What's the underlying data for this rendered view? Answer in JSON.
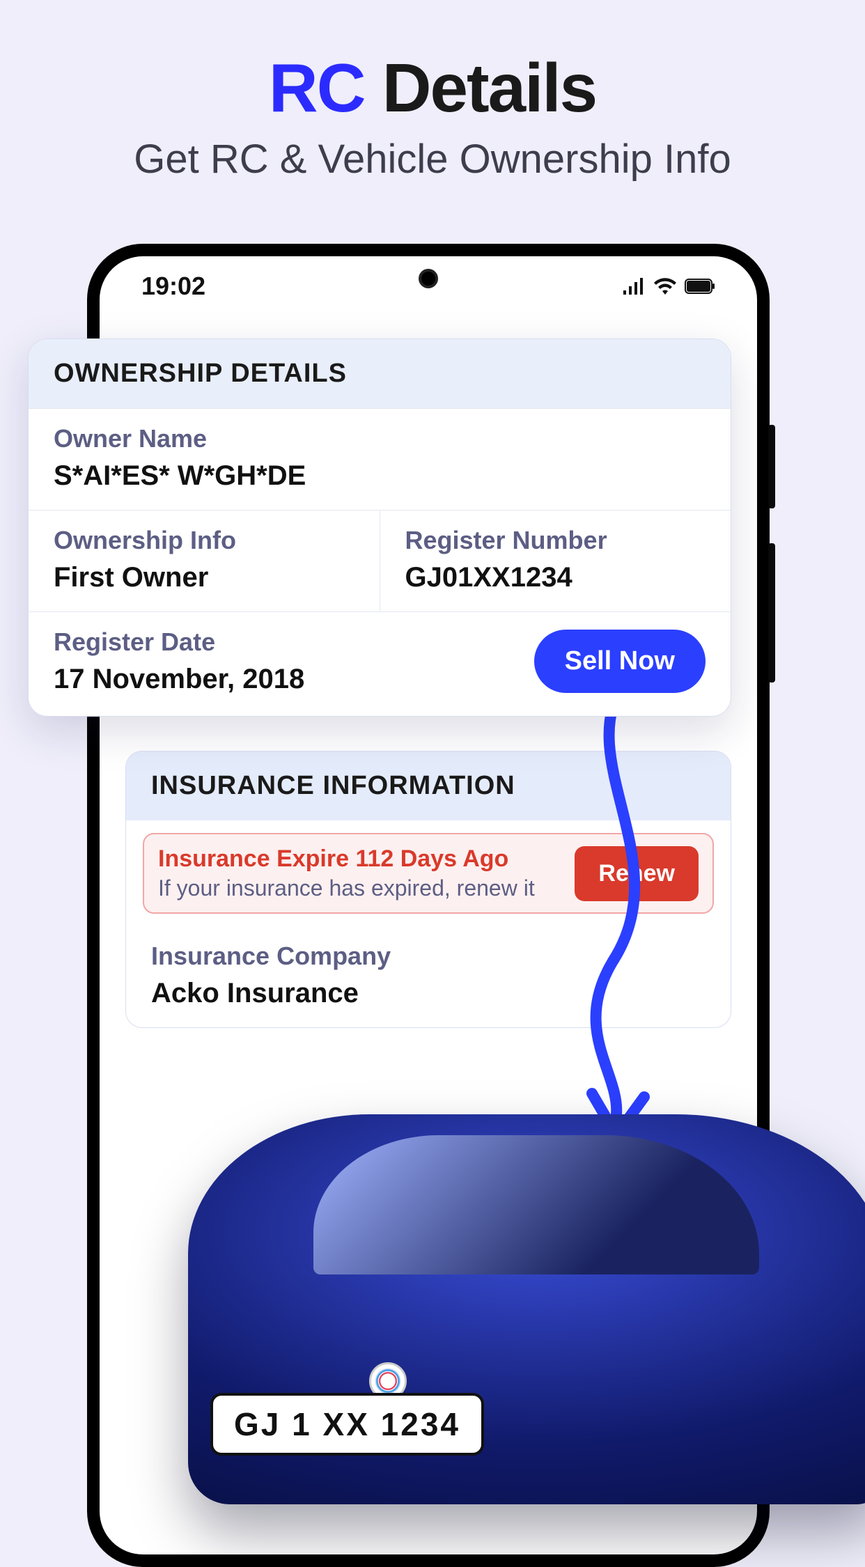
{
  "page": {
    "title_prefix": "RC",
    "title_suffix": " Details",
    "subtitle": "Get RC & Vehicle Ownership Info"
  },
  "status_bar": {
    "time": "19:02"
  },
  "ownership": {
    "header": "OWNERSHIP DETAILS",
    "owner_name_label": "Owner Name",
    "owner_name": "S*AI*ES* W*GH*DE",
    "ownership_info_label": "Ownership Info",
    "ownership_info": "First Owner",
    "register_number_label": "Register Number",
    "register_number": "GJ01XX1234",
    "register_date_label": "Register Date",
    "register_date": "17 November, 2018",
    "sell_button": "Sell Now"
  },
  "insurance": {
    "header": "INSURANCE INFORMATION",
    "alert_title": "Insurance Expire 112 Days Ago",
    "alert_subtitle": "If your insurance has expired, renew it",
    "renew_button": "Renew",
    "company_label": "Insurance Company",
    "company": "Acko Insurance"
  },
  "car": {
    "plate": "GJ 1 XX 1234"
  },
  "colors": {
    "accent": "#2b3fff",
    "danger": "#d93a2b"
  }
}
